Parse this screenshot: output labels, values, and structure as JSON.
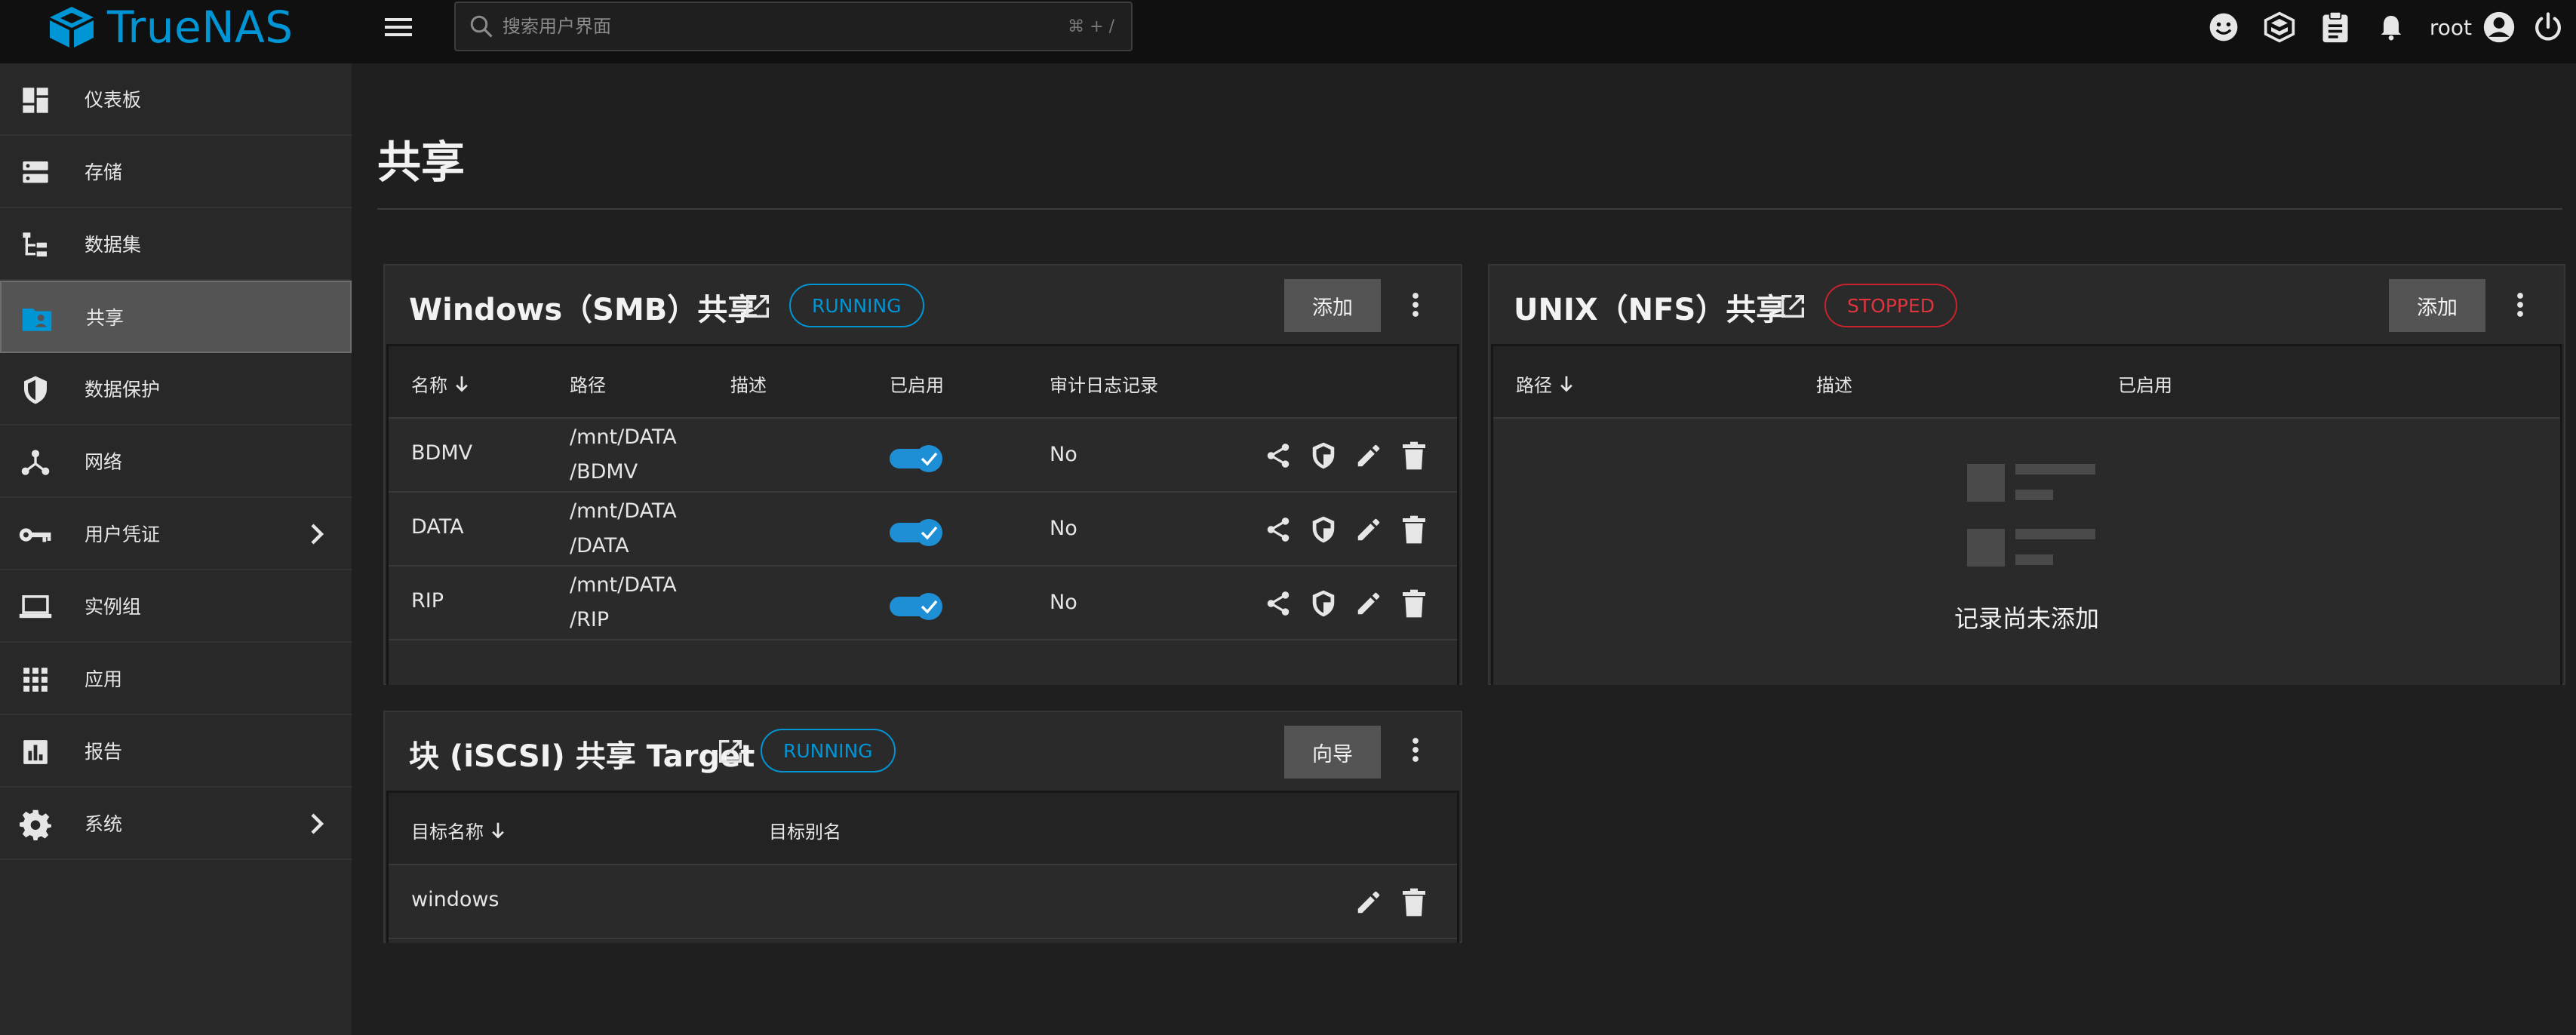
{
  "app": {
    "brand": "TrueNAS",
    "brand_color": "#0095d5"
  },
  "topbar": {
    "search_placeholder": "搜索用户界面",
    "search_shortcut": "⌘ + /",
    "username": "root"
  },
  "sidebar": {
    "items": [
      {
        "label": "仪表板",
        "icon": "dashboard-icon"
      },
      {
        "label": "存储",
        "icon": "storage-icon"
      },
      {
        "label": "数据集",
        "icon": "dataset-icon"
      },
      {
        "label": "共享",
        "icon": "share-folder-icon",
        "active": true
      },
      {
        "label": "数据保护",
        "icon": "shield-icon"
      },
      {
        "label": "网络",
        "icon": "network-icon"
      },
      {
        "label": "用户凭证",
        "icon": "key-icon",
        "has_children": true
      },
      {
        "label": "实例组",
        "icon": "laptop-icon"
      },
      {
        "label": "应用",
        "icon": "apps-grid-icon"
      },
      {
        "label": "报告",
        "icon": "report-chart-icon"
      },
      {
        "label": "系统",
        "icon": "gear-icon",
        "has_children": true
      }
    ]
  },
  "page": {
    "title": "共享"
  },
  "smb": {
    "title": "Windows（SMB）共享",
    "status": "RUNNING",
    "add_label": "添加",
    "columns": [
      "名称",
      "路径",
      "描述",
      "已启用",
      "审计日志记录"
    ],
    "rows": [
      {
        "name": "BDMV",
        "path_line1": "/mnt/DATA",
        "path_line2": "/BDMV",
        "description": "",
        "enabled": true,
        "audit": "No"
      },
      {
        "name": "DATA",
        "path_line1": "/mnt/DATA",
        "path_line2": "/DATA",
        "description": "",
        "enabled": true,
        "audit": "No"
      },
      {
        "name": "RIP",
        "path_line1": "/mnt/DATA",
        "path_line2": "/RIP",
        "description": "",
        "enabled": true,
        "audit": "No"
      }
    ]
  },
  "nfs": {
    "title": "UNIX（NFS）共享",
    "status": "STOPPED",
    "add_label": "添加",
    "columns": [
      "路径",
      "描述",
      "已启用"
    ],
    "empty_text": "记录尚未添加"
  },
  "iscsi": {
    "title": "块 (iSCSI) 共享 Target",
    "status": "RUNNING",
    "wizard_label": "向导",
    "columns": [
      "目标名称",
      "目标别名"
    ],
    "rows": [
      {
        "name": "windows",
        "alias": ""
      }
    ]
  },
  "colors": {
    "accent": "#0095d5",
    "stopped": "#e0353e",
    "toggle_on": "#1e8fd4"
  }
}
